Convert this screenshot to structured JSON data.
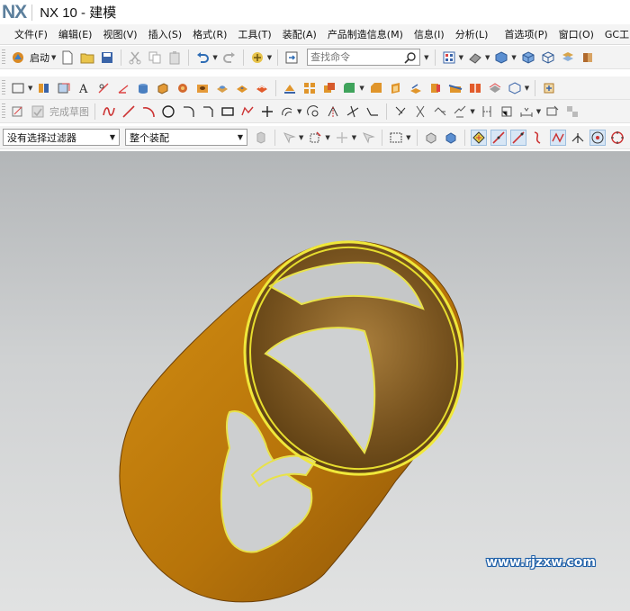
{
  "app": {
    "logo": "NX",
    "title": "NX 10 - 建模"
  },
  "menu": {
    "items": [
      "文件(F)",
      "编辑(E)",
      "视图(V)",
      "插入(S)",
      "格式(R)",
      "工具(T)",
      "装配(A)",
      "产品制造信息(M)",
      "信息(I)",
      "分析(L)",
      "首选项(P)",
      "窗口(O)",
      "GC工"
    ]
  },
  "toolbar1": {
    "start_label": "启动",
    "search_placeholder": "查找命令"
  },
  "toolbar3": {
    "finish_sketch_label": "完成草图"
  },
  "toolbar4": {
    "filter_value": "没有选择过滤器",
    "scope_value": "整个装配"
  },
  "viewport": {
    "watermark": "www.rjzxw.com"
  },
  "colors": {
    "accent_blue": "#2f6db5",
    "model_orange": "#c8870a",
    "edge_yellow": "#f0e83a"
  }
}
